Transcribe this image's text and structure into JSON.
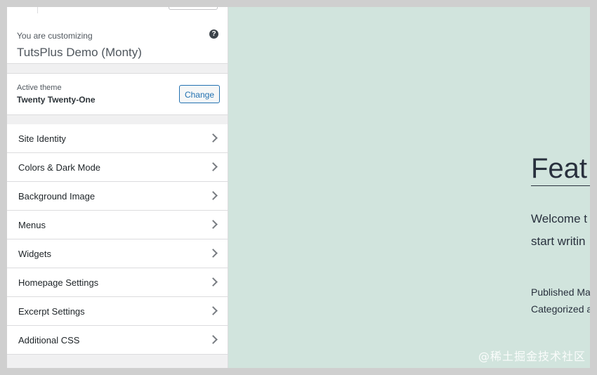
{
  "customizer": {
    "customizing_label": "You are customizing",
    "site_name": "TutsPlus Demo (Monty)",
    "help_icon": "question-circle-icon"
  },
  "theme": {
    "label": "Active theme",
    "name": "Twenty Twenty-One",
    "change_label": "Change"
  },
  "menu": {
    "items": [
      {
        "label": "Site Identity"
      },
      {
        "label": "Colors & Dark Mode"
      },
      {
        "label": "Background Image"
      },
      {
        "label": "Menus"
      },
      {
        "label": "Widgets"
      },
      {
        "label": "Homepage Settings"
      },
      {
        "label": "Excerpt Settings"
      },
      {
        "label": "Additional CSS"
      }
    ]
  },
  "preview": {
    "title": "Feat",
    "line1": "Welcome t",
    "line2": "start writin",
    "meta1": "Published Ma",
    "meta2": "Categorized a",
    "background": "#d1e4dd"
  },
  "watermark": "@稀土掘金技术社区",
  "colors": {
    "accent": "#2271b1",
    "sidebar_bg": "#f0f0f1"
  }
}
